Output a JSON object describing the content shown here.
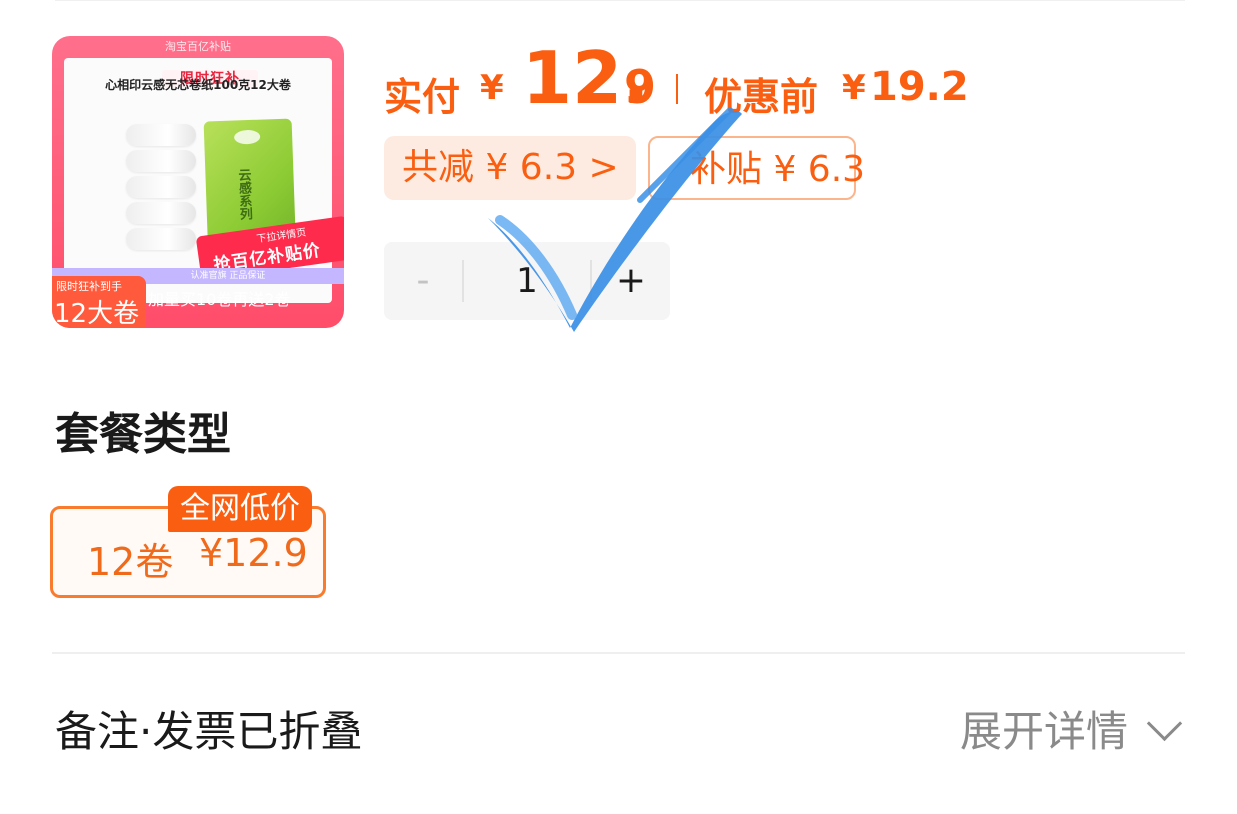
{
  "product": {
    "image_top_small": "淘宝百亿补贴",
    "image_badge": "限时狂补",
    "image_title": "心相印云感无芯卷纸100克12大卷",
    "image_package_text": "云感系列",
    "image_promo_small": "下拉详情页",
    "image_promo_big": "抢百亿补贴价",
    "image_bottom_strip": "认准官旗 正品保证",
    "image_corner_small": "限时狂补到手",
    "image_corner_big": "12大卷",
    "image_footer": "加量买10卷再送2卷"
  },
  "price": {
    "pay_label": "实付",
    "currency": "¥",
    "pay_integer": "12.",
    "pay_decimal": "9",
    "separator": "|",
    "original_label": "优惠前",
    "original_value": "19.2"
  },
  "discounts": {
    "total_label": "共减 ¥ 6.3 >",
    "subsidy_label": "补贴 ¥ 6.3"
  },
  "quantity": {
    "minus": "-",
    "value": "1",
    "plus": "+"
  },
  "package": {
    "section_title": "套餐类型",
    "option_name": "12卷",
    "option_price": "¥12.9",
    "option_badge": "全网低价"
  },
  "footer": {
    "note_label": "备注·发票已折叠",
    "expand_label": "展开详情"
  },
  "colors": {
    "accent": "#fa5f11",
    "checkmark": "#3a8fe6"
  }
}
